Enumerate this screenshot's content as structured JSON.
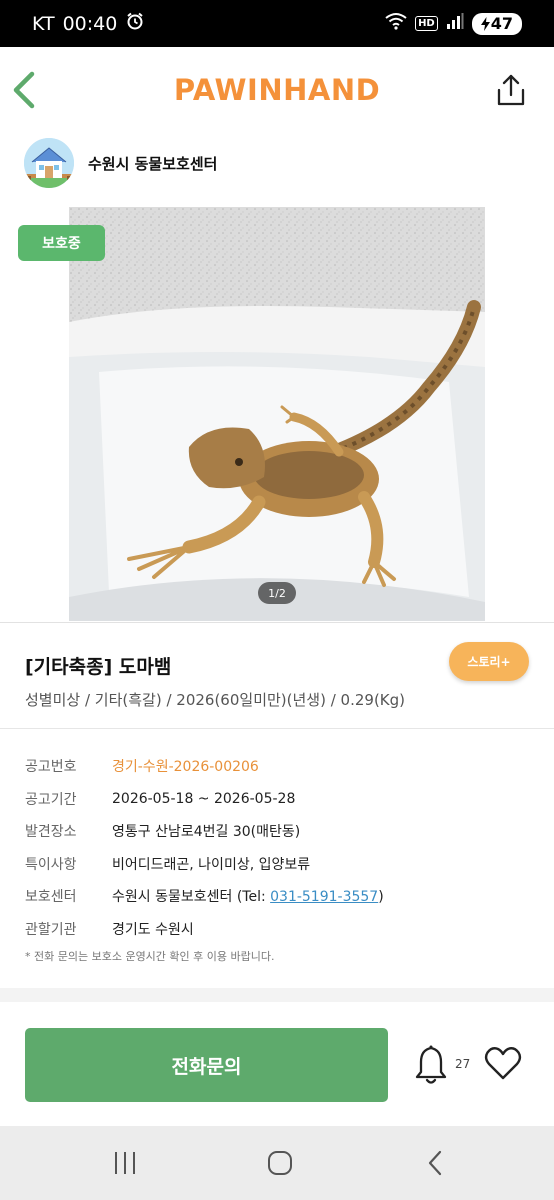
{
  "status_bar": {
    "carrier": "KT",
    "time": "00:40",
    "hd": "HD",
    "battery": "47"
  },
  "header": {
    "brand": "PAWINHAND"
  },
  "center": {
    "name": "수원시 동물보호센터"
  },
  "photo": {
    "status_tag": "보호중",
    "page_indicator": "1/2"
  },
  "animal": {
    "title": "[기타축종] 도마뱀",
    "story_label": "스토리+",
    "subtitle": "성별미상 / 기타(흑갈) / 2026(60일미만)(년생) / 0.29(Kg)"
  },
  "info": {
    "notice_no_label": "공고번호",
    "notice_no": "경기-수원-2026-00206",
    "period_label": "공고기간",
    "period": "2026-05-18 ~ 2026-05-28",
    "found_label": "발견장소",
    "found": "영통구 산남로4번길 30(매탄동)",
    "special_label": "특이사항",
    "special": "비어디드래곤, 나이미상, 입양보류",
    "center_label": "보호센터",
    "center_prefix": "수원시 동물보호센터 (Tel: ",
    "tel": "031-5191-3557",
    "center_suffix": ")",
    "agency_label": "관할기관",
    "agency": "경기도 수원시",
    "note": "* 전화 문의는 보호소 운영시간 확인 후 이용 바랍니다."
  },
  "actions": {
    "call_label": "전화문의",
    "bell_count": "27"
  },
  "colors": {
    "brand": "#f4913a",
    "status_tag": "#5bb76d",
    "call_button": "#5eaa6c",
    "story": "#f7b45a",
    "notice_no": "#e8913a",
    "tel": "#3a8dc4"
  }
}
